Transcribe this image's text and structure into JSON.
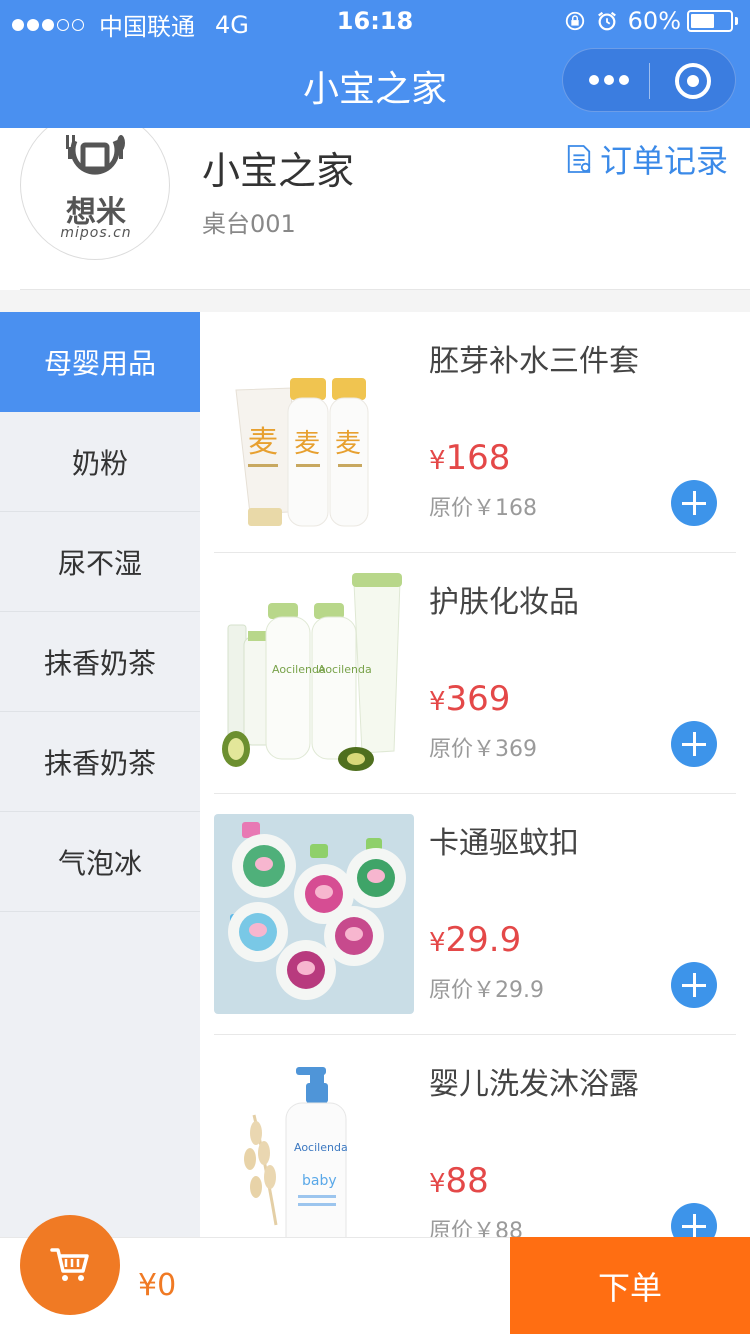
{
  "status_bar": {
    "carrier": "中国联通",
    "network": "4G",
    "time": "16:18",
    "battery": "60%",
    "battery_level": 0.6
  },
  "nav": {
    "title": "小宝之家"
  },
  "shop": {
    "logo_cn": "想米",
    "logo_en": "mipos.cn",
    "name": "小宝之家",
    "table": "桌台001",
    "orders_label": "订单记录"
  },
  "categories": [
    {
      "label": "母婴用品",
      "active": true
    },
    {
      "label": "奶粉"
    },
    {
      "label": "尿不湿"
    },
    {
      "label": "抹香奶茶"
    },
    {
      "label": "抹香奶茶"
    },
    {
      "label": "气泡冰"
    }
  ],
  "products": [
    {
      "name": "胚芽补水三件套",
      "currency": "¥",
      "price": "168",
      "original": "原价￥168"
    },
    {
      "name": "护肤化妆品",
      "currency": "¥",
      "price": "369",
      "original": "原价￥369"
    },
    {
      "name": "卡通驱蚊扣",
      "currency": "¥",
      "price": "29.9",
      "original": "原价￥29.9"
    },
    {
      "name": "婴儿洗发沐浴露",
      "currency": "¥",
      "price": "88",
      "original": "原价￥88"
    }
  ],
  "bottom": {
    "total": "¥0",
    "order_label": "下单"
  },
  "colors": {
    "primary_blue": "#4a90f0",
    "price_red": "#e44848",
    "cart_orange": "#f07a24",
    "order_orange": "#ff6e12"
  }
}
